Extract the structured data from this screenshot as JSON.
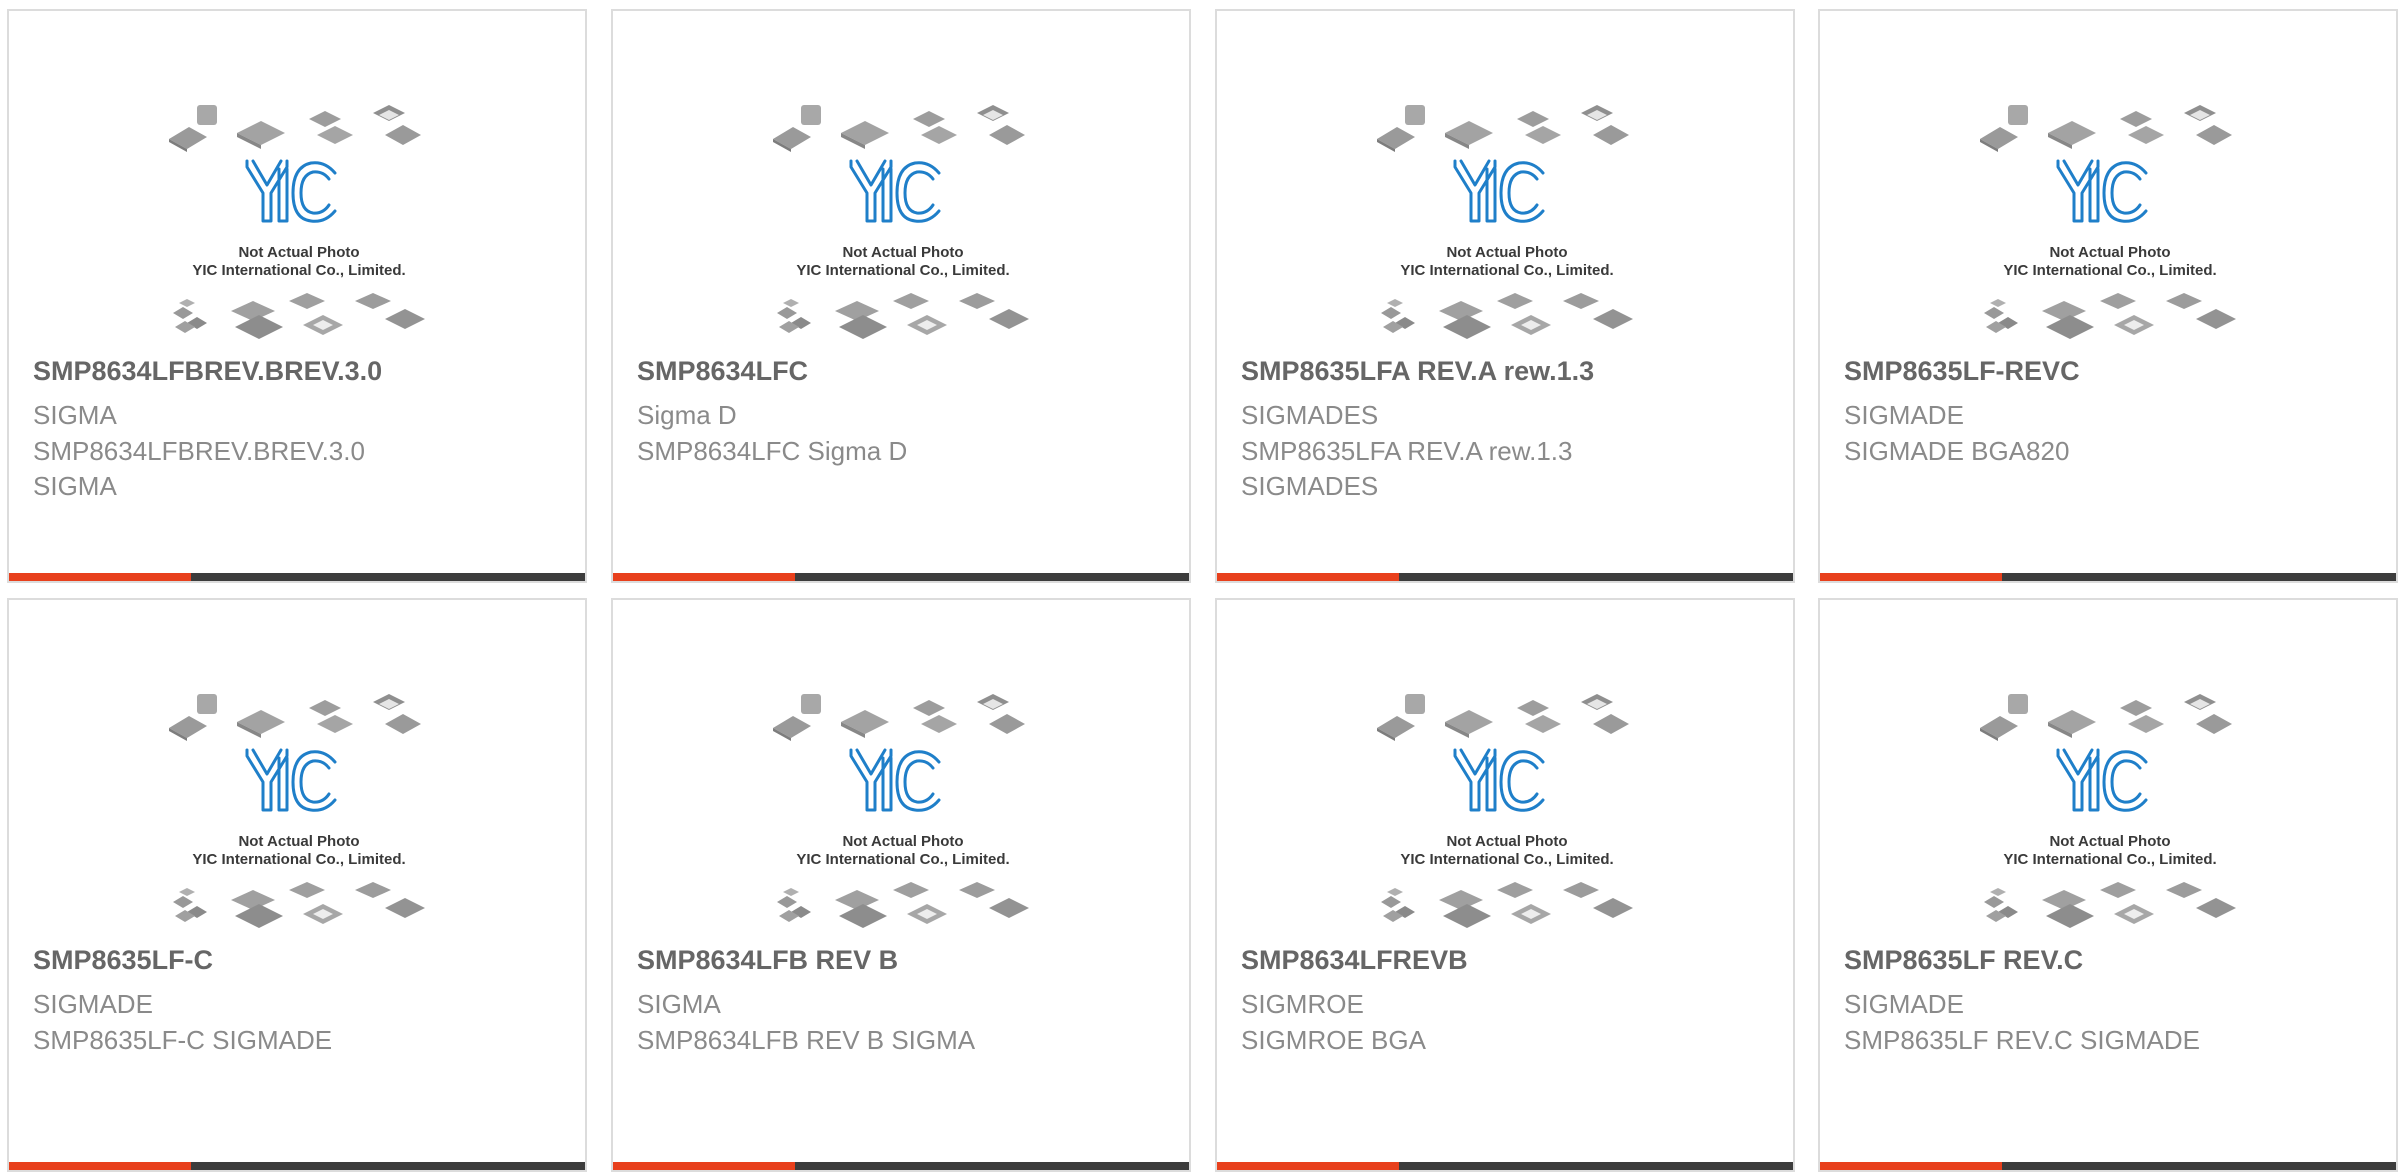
{
  "placeholder": {
    "line1": "Not Actual Photo",
    "line2": "YIC International Co., Limited.",
    "logo_text": "YIC"
  },
  "colors": {
    "accent_red": "#e8401c",
    "accent_dark": "#3c3c3c",
    "logo_blue": "#1f7fc9"
  },
  "cards": [
    {
      "name": "SMP8634LFBREV.BREV.3.0",
      "brand": "SIGMA",
      "desc": "SMP8634LFBREV.BREV.3.0",
      "desc2": "SIGMA"
    },
    {
      "name": "SMP8634LFC",
      "brand": "Sigma D",
      "desc": "SMP8634LFC Sigma D",
      "desc2": ""
    },
    {
      "name": "SMP8635LFA REV.A rew.1.3",
      "brand": "SIGMADES",
      "desc": "SMP8635LFA REV.A rew.1.3",
      "desc2": "SIGMADES"
    },
    {
      "name": "SMP8635LF-REVC",
      "brand": "SIGMADE",
      "desc": "SIGMADE BGA820",
      "desc2": ""
    },
    {
      "name": "SMP8635LF-C",
      "brand": "SIGMADE",
      "desc": "SMP8635LF-C SIGMADE",
      "desc2": ""
    },
    {
      "name": "SMP8634LFB REV B",
      "brand": "SIGMA",
      "desc": "SMP8634LFB REV B SIGMA",
      "desc2": ""
    },
    {
      "name": "SMP8634LFREVB",
      "brand": "SIGMROE",
      "desc": "SIGMROE BGA",
      "desc2": ""
    },
    {
      "name": "SMP8635LF REV.C",
      "brand": "SIGMADE",
      "desc": "SMP8635LF REV.C SIGMADE",
      "desc2": ""
    }
  ]
}
